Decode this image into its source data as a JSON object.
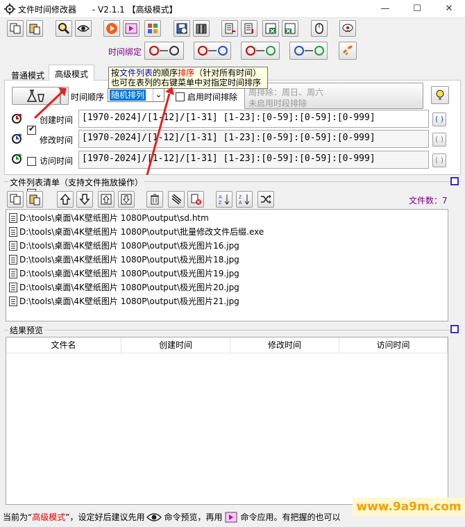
{
  "window": {
    "title": "文件时间修改器      - V2.1.1 【高级模式】",
    "minimize": "—",
    "maximize": "☐",
    "close": "✕"
  },
  "toolbar": {
    "bind_label": "时间绑定"
  },
  "tabs": [
    {
      "label": "普通模式"
    },
    {
      "label": "高级模式"
    }
  ],
  "advanced": {
    "time_order_label": "时间顺序",
    "time_order_value": "随机排列",
    "enable_exclusion_label": "启用时间排除",
    "exclusion_text_line1": "周排除：周日、周六",
    "exclusion_text_line2": "未启用时段排除",
    "tooltip_line1_pre": "按",
    "tooltip_line1_link": "文件列表",
    "tooltip_line1_mid": "的顺序",
    "tooltip_line1_red": "排序",
    "tooltip_line1_post": "（针对所有时间）",
    "tooltip_line2": "也可在表列的右键菜单中对指定时间排序",
    "rows": [
      {
        "label": "创建时间",
        "checked": true,
        "value": "[1970-2024]/[1-12]/[1-31] [1-23]:[0-59]:[0-59]:[0-999]",
        "btn": "( )"
      },
      {
        "label": "修改时间",
        "checked": false,
        "value": "[1970-2024]/[1-12]/[1-31] [1-23]:[0-59]:[0-59]:[0-999]",
        "btn": "( )"
      },
      {
        "label": "访问时间",
        "checked": false,
        "value": "[1970-2024]/[1-12]/[1-31] [1-23]:[0-59]:[0-59]:[0-999]",
        "btn": "( )"
      }
    ]
  },
  "file_list": {
    "section_title": "文件列表清单（支持文件拖放操作）",
    "count_label": "文件数：7",
    "files": [
      "D:\\tools\\桌面\\4K壁纸图片 1080P\\output\\sd.htm",
      "D:\\tools\\桌面\\4K壁纸图片 1080P\\output\\批量修改文件后缀.exe",
      "D:\\tools\\桌面\\4K壁纸图片 1080P\\output\\极光图片16.jpg",
      "D:\\tools\\桌面\\4K壁纸图片 1080P\\output\\极光图片18.jpg",
      "D:\\tools\\桌面\\4K壁纸图片 1080P\\output\\极光图片19.jpg",
      "D:\\tools\\桌面\\4K壁纸图片 1080P\\output\\极光图片20.jpg",
      "D:\\tools\\桌面\\4K壁纸图片 1080P\\output\\极光图片21.jpg"
    ]
  },
  "preview": {
    "section_title": "结果预览",
    "columns": [
      "文件名",
      "创建时间",
      "修改时间",
      "访问时间"
    ]
  },
  "statusbar": {
    "part1": "当前为“",
    "mode": "高级模式",
    "part2": "”，设定好后建议先用",
    "part3": "命令预览，再用",
    "part4": "命令应用。有把握的也可以"
  },
  "watermark": "www.9a9m.com",
  "colors": {
    "accent_red": "#e00000",
    "count_purple": "#800080",
    "tooltip_bg": "#ffffe1",
    "watermark": "#f5a000"
  }
}
